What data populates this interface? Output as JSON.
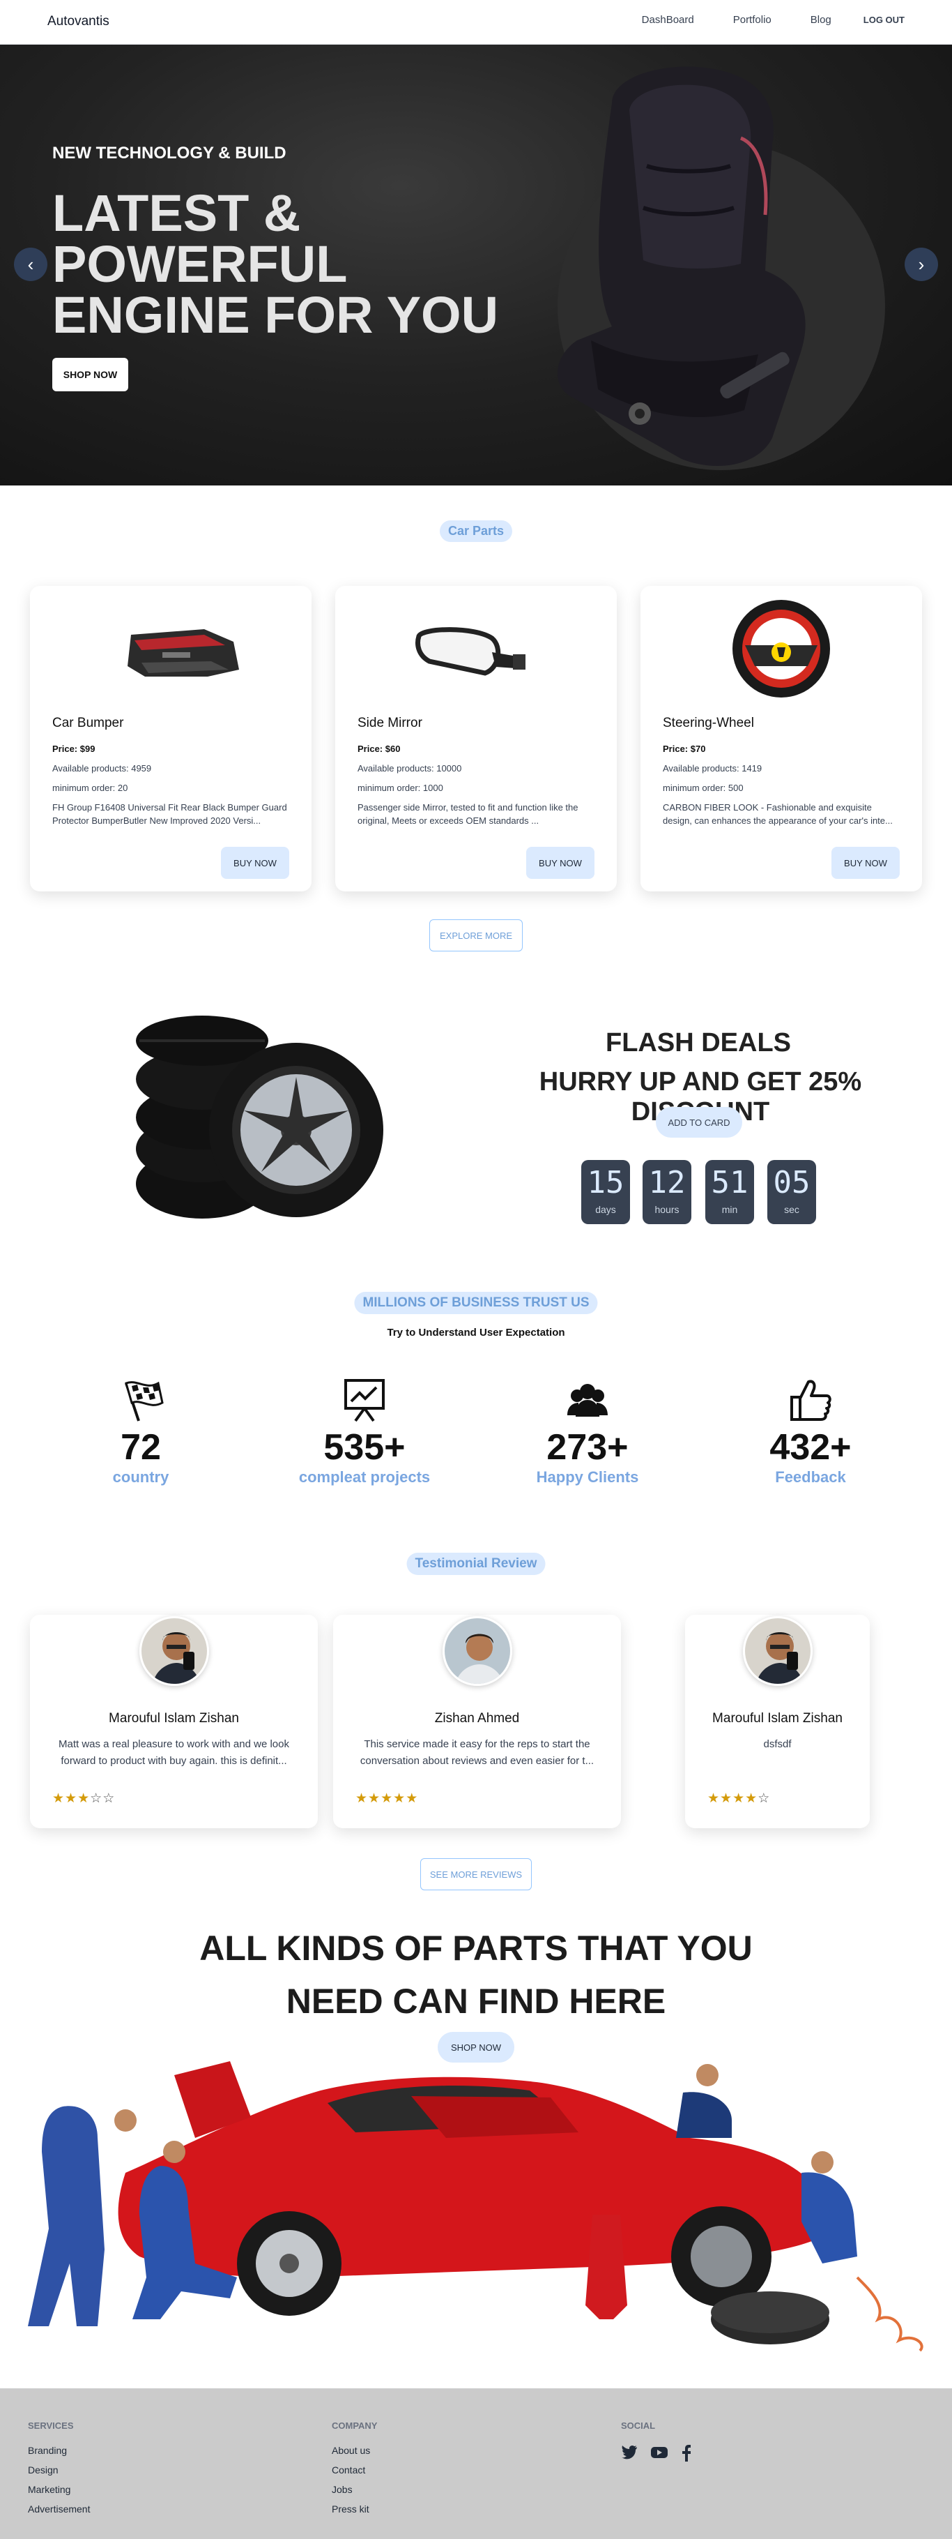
{
  "nav": {
    "brand": "Autovantis",
    "links": [
      "DashBoard",
      "Portfolio",
      "Blog"
    ],
    "logout": "LOG OUT"
  },
  "hero": {
    "subtitle": "NEW TECHNOLOGY & BUILD",
    "title": "LATEST & POWERFUL ENGINE FOR YOU",
    "button": "SHOP NOW",
    "prev_icon": "chevron-left-icon",
    "next_icon": "chevron-right-icon"
  },
  "parts": {
    "heading": "Car Parts",
    "items": [
      {
        "name": "Car Bumper",
        "price": "Price: $99",
        "available": "Available products: 4959",
        "minimum": "minimum order: 20",
        "description": "FH Group F16408 Universal Fit Rear Black Bumper Guard Protector BumperButler New Improved 2020 Versi...",
        "button": "BUY NOW"
      },
      {
        "name": "Side Mirror",
        "price": "Price: $60",
        "available": "Available products: 10000",
        "minimum": "minimum order: 1000",
        "description": "Passenger side Mirror, tested to fit and function like the original, Meets or exceeds OEM standards ...",
        "button": "BUY NOW"
      },
      {
        "name": "Steering-Wheel",
        "price": "Price: $70",
        "available": "Available products: 1419",
        "minimum": "minimum order: 500",
        "description": "CARBON FIBER LOOK - Fashionable and exquisite design, can enhances the appearance of your car's inte...",
        "button": "BUY NOW"
      }
    ],
    "explore": "EXPLORE MORE"
  },
  "flash": {
    "title": "FLASH DEALS",
    "subtitle": "HURRY UP AND GET 25% DISCOUNT",
    "button": "ADD TO CARD",
    "countdown": [
      {
        "value": "15",
        "unit": "days"
      },
      {
        "value": "12",
        "unit": "hours"
      },
      {
        "value": "51",
        "unit": "min"
      },
      {
        "value": "05",
        "unit": "sec"
      }
    ]
  },
  "trust": {
    "heading": "MILLIONS OF BUSINESS TRUST US",
    "subheading": "Try to Understand User Expectation",
    "stats": [
      {
        "icon": "checkered-flag-icon",
        "value": "72",
        "label": "country"
      },
      {
        "icon": "presentation-chart-icon",
        "value": "535+",
        "label": "compleat projects"
      },
      {
        "icon": "users-icon",
        "value": "273+",
        "label": "Happy Clients"
      },
      {
        "icon": "thumbs-up-icon",
        "value": "432+",
        "label": "Feedback"
      }
    ]
  },
  "testimonials": {
    "heading": "Testimonial Review",
    "items": [
      {
        "name": "Marouful Islam Zishan",
        "text": "Matt was a real pleasure to work with and we look forward to product with buy again. this is definit...",
        "rating": 3
      },
      {
        "name": "Zishan Ahmed",
        "text": "This service made it easy for the reps to start the conversation about reviews and even easier for t...",
        "rating": 5
      },
      {
        "name": "Marouful Islam Zishan",
        "text": "dsfsdf",
        "rating": 4
      }
    ],
    "more": "SEE MORE REVIEWS"
  },
  "promo": {
    "line1": "ALL KINDS OF PARTS THAT YOU",
    "line2": "NEED CAN FIND HERE",
    "button": "SHOP NOW"
  },
  "footer": {
    "services": {
      "title": "SERVICES",
      "items": [
        "Branding",
        "Design",
        "Marketing",
        "Advertisement"
      ]
    },
    "company": {
      "title": "COMPANY",
      "items": [
        "About us",
        "Contact",
        "Jobs",
        "Press kit"
      ]
    },
    "social": {
      "title": "SOCIAL",
      "icons": [
        "twitter-icon",
        "youtube-icon",
        "facebook-icon"
      ]
    }
  }
}
